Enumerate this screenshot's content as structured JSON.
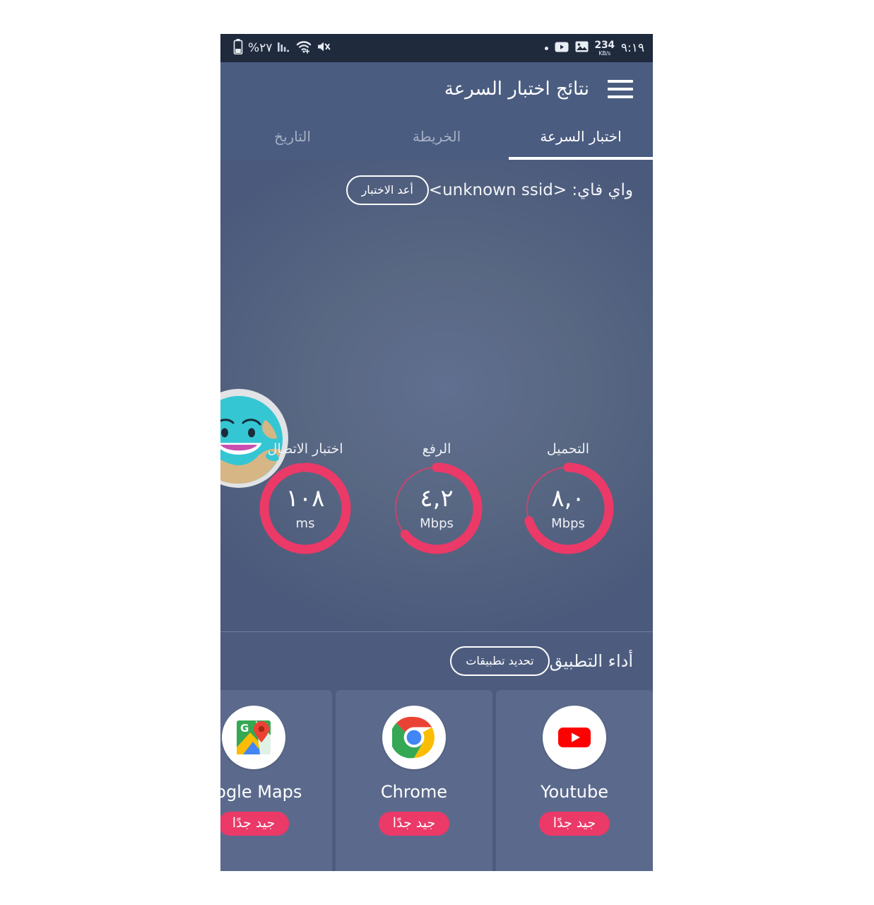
{
  "status_bar": {
    "battery_percent": "%٢٧",
    "data_rate_value": "234",
    "data_rate_unit": "KB/s",
    "time": "٩:١٩",
    "icons_left": [
      "battery-icon",
      "signal-bars-icon",
      "wifi-icon",
      "mute-icon"
    ],
    "icons_right": [
      "dot-indicator-icon",
      "youtube-notification-icon",
      "image-notification-icon"
    ]
  },
  "header": {
    "title": "نتائج اختبار السرعة",
    "menu_icon": "hamburger-menu-icon"
  },
  "tabs": [
    {
      "label": "اختبار السرعة",
      "active": true
    },
    {
      "label": "الخريطة",
      "active": false
    },
    {
      "label": "التاريخ",
      "active": false
    }
  ],
  "speed_test": {
    "network_label": "واي فاي: <unknown ssid>",
    "retest_button": "أعد الاختبار",
    "gauges": [
      {
        "label": "التحميل",
        "value": "٨,٠",
        "unit": "Mbps",
        "percent": 70,
        "name": "download"
      },
      {
        "label": "الرفع",
        "value": "٤,٢",
        "unit": "Mbps",
        "percent": 64,
        "name": "upload"
      },
      {
        "label": "اختبار الاتصال",
        "value": "١٠٨",
        "unit": "ms",
        "percent": 98,
        "name": "ping"
      }
    ]
  },
  "app_performance": {
    "title": "أداء التطبيق",
    "select_apps_button": "تحديد تطبيقات",
    "cards": [
      {
        "name": "Youtube",
        "rating": "جيد جدًا",
        "icon": "youtube-icon"
      },
      {
        "name": "Chrome",
        "rating": "جيد جدًا",
        "icon": "chrome-icon"
      },
      {
        "name": "oogle Maps",
        "rating": "جيد جدًا",
        "icon": "google-maps-icon"
      }
    ]
  },
  "colors": {
    "accent_pink": "#eb3968",
    "header_blue": "#4a5c80",
    "status_bar": "#1f2a3d",
    "card_blue": "#5b6a8c"
  }
}
